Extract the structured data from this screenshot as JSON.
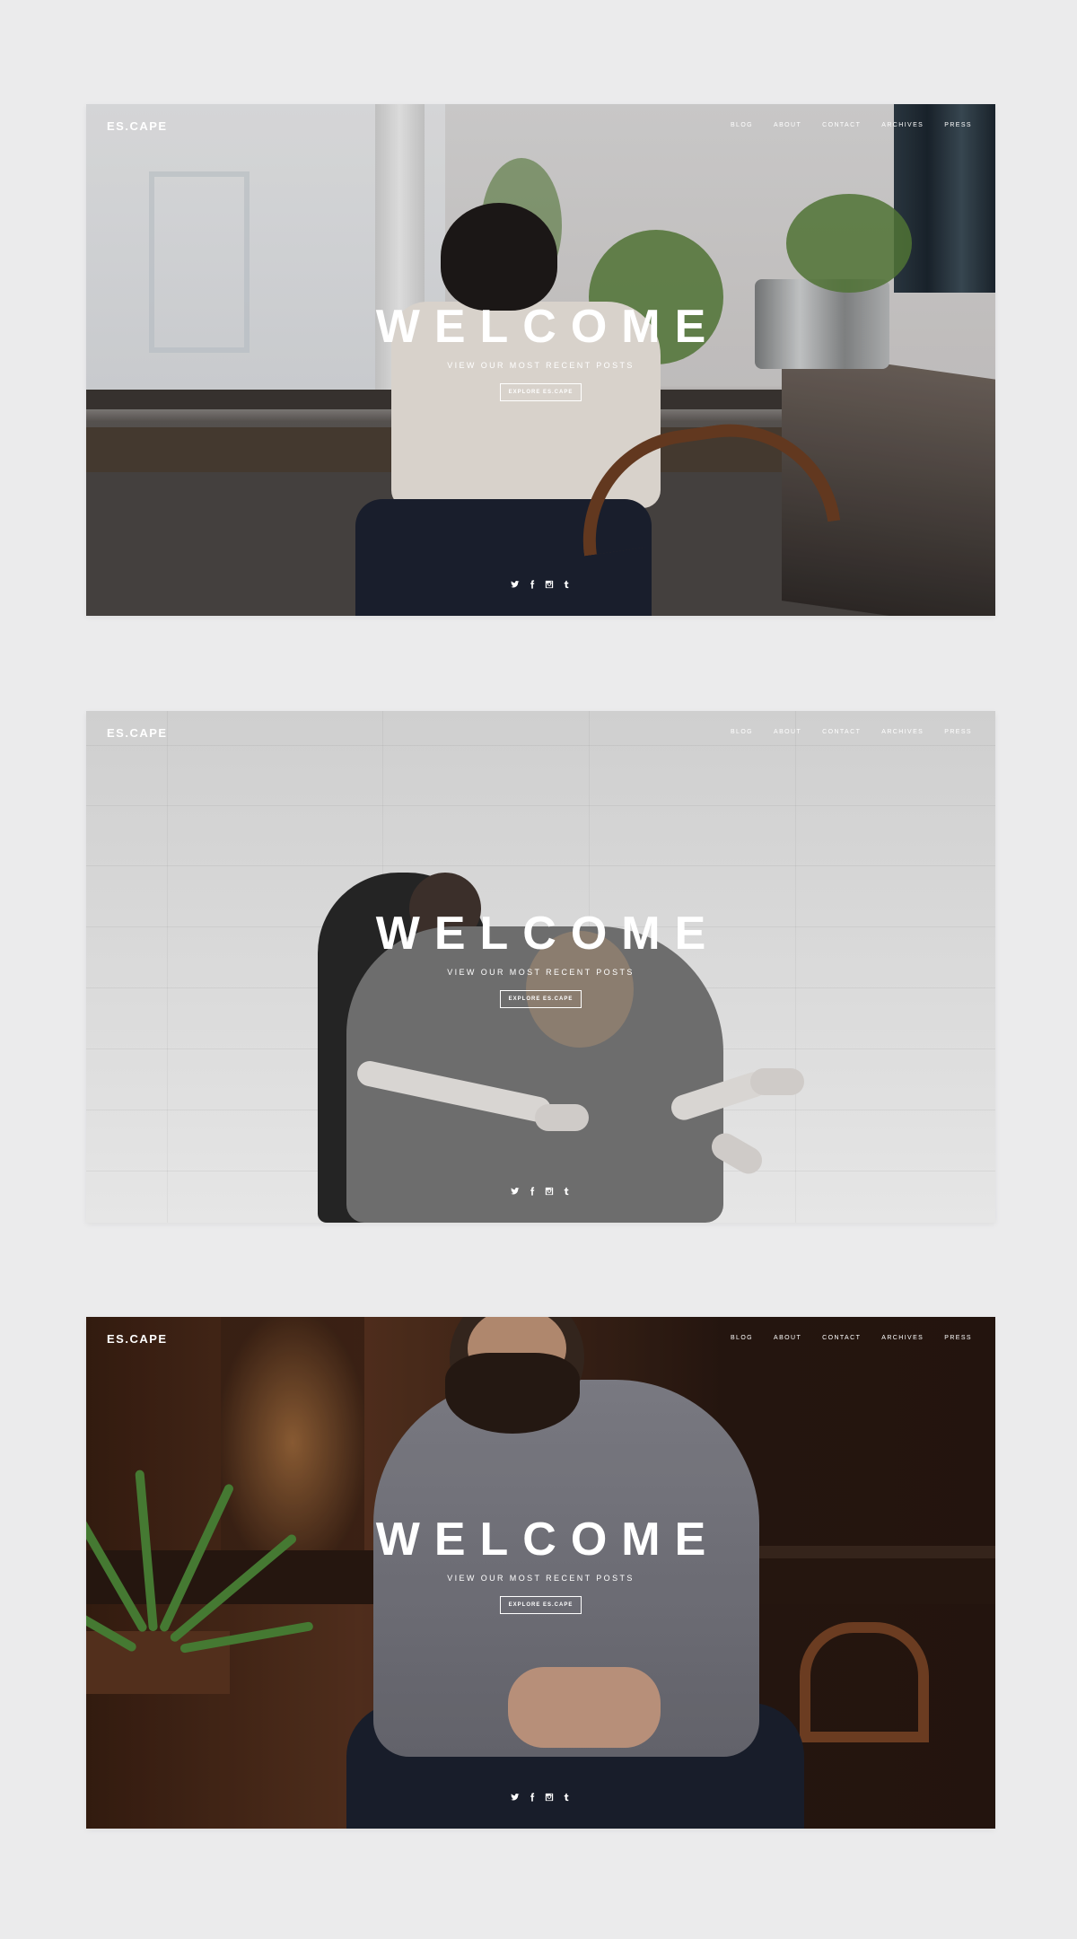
{
  "mockups": [
    {
      "logo": "ES.CAPE",
      "nav": [
        "BLOG",
        "ABOUT",
        "CONTACT",
        "ARCHIVES",
        "PRESS"
      ],
      "hero": {
        "title": "WELCOME",
        "subtitle": "VIEW OUR MOST RECENT POSTS",
        "button": "EXPLORE ES.CAPE"
      },
      "social": [
        "twitter-icon",
        "facebook-icon",
        "instagram-icon",
        "tumblr-icon"
      ]
    },
    {
      "logo": "ES.CAPE",
      "nav": [
        "BLOG",
        "ABOUT",
        "CONTACT",
        "ARCHIVES",
        "PRESS"
      ],
      "hero": {
        "title": "WELCOME",
        "subtitle": "VIEW OUR MOST RECENT POSTS",
        "button": "EXPLORE ES.CAPE"
      },
      "social": [
        "twitter-icon",
        "facebook-icon",
        "instagram-icon",
        "tumblr-icon"
      ]
    },
    {
      "logo": "ES.CAPE",
      "nav": [
        "BLOG",
        "ABOUT",
        "CONTACT",
        "ARCHIVES",
        "PRESS"
      ],
      "hero": {
        "title": "WELCOME",
        "subtitle": "VIEW OUR MOST RECENT POSTS",
        "button": "EXPLORE ES.CAPE"
      },
      "social": [
        "twitter-icon",
        "facebook-icon",
        "instagram-icon",
        "tumblr-icon"
      ]
    }
  ],
  "colors": {
    "page_background": "#ebebec",
    "text": "#ffffff"
  }
}
